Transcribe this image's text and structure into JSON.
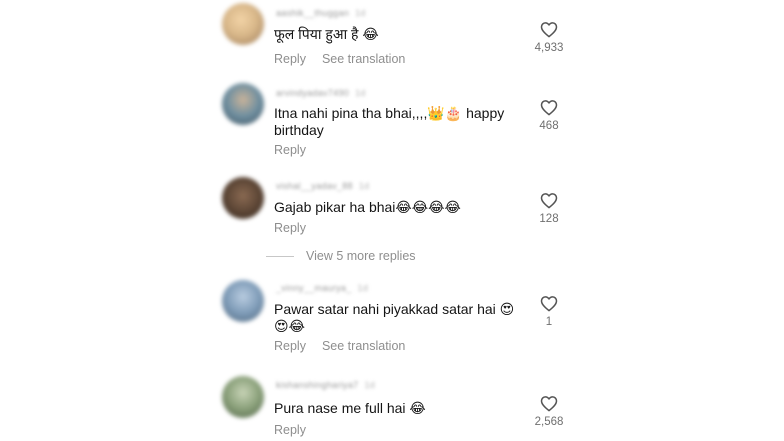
{
  "comments": [
    {
      "username": "aashik__thuggan",
      "time": "1d",
      "text": "फूल पिया हुआ है 😂",
      "reply_label": "Reply",
      "translate_label": "See translation",
      "likes": "4,933",
      "avatar_color": "#d9b88a"
    },
    {
      "username": "arvindyadav7490",
      "time": "1d",
      "text": "Itna nahi pina tha bhai,,,,👑🎂 happy birthday",
      "reply_label": "Reply",
      "translate_label": "",
      "likes": "468",
      "avatar_color": "#6f8fa0"
    },
    {
      "username": "vishal__yadav_88",
      "time": "1d",
      "text": "Gajab pikar ha bhai😂😂😂😂",
      "reply_label": "Reply",
      "translate_label": "",
      "likes": "128",
      "avatar_color": "#5a4434"
    },
    {
      "username": "_vinny__maurya_",
      "time": "1d",
      "text": "Pawar satar nahi piyakkad satar hai 😍😍😂",
      "reply_label": "Reply",
      "translate_label": "See translation",
      "likes": "1",
      "avatar_color": "#7f9cb8"
    },
    {
      "username": "kishanshinghariya7",
      "time": "1d",
      "text": "Pura nase me full hai 😂",
      "reply_label": "Reply",
      "translate_label": "",
      "likes": "2,568",
      "avatar_color": "#8aa07a"
    }
  ],
  "view_more_replies": "View 5 more replies",
  "icons": {
    "like": "heart-outline-icon"
  },
  "colors": {
    "secondary_text": "#8e8e8e",
    "primary_text": "#141414"
  }
}
